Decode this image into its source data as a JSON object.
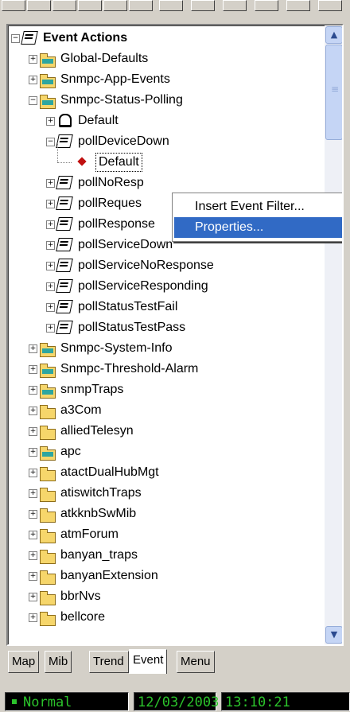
{
  "tree": {
    "rows": [
      {
        "label": "Event Actions",
        "bold": true,
        "icon": "event-actions-icon",
        "expander": "minus"
      },
      {
        "label": "Global-Defaults",
        "icon": "folder-teal-icon",
        "expander": "plus"
      },
      {
        "label": "Snmpc-App-Events",
        "icon": "folder-teal-icon",
        "expander": "plus"
      },
      {
        "label": "Snmpc-Status-Polling",
        "icon": "folder-teal-open-icon",
        "expander": "minus"
      },
      {
        "label": "Default",
        "icon": "bell-icon",
        "expander": "plus"
      },
      {
        "label": "pollDeviceDown",
        "icon": "event-action-icon",
        "expander": "minus"
      },
      {
        "label": "Default",
        "icon": "red-diamond-icon",
        "expander": "none"
      },
      {
        "label": "pollNoResp",
        "icon": "event-action-icon",
        "expander": "plus"
      },
      {
        "label": "pollReques",
        "icon": "event-action-icon",
        "expander": "plus"
      },
      {
        "label": "pollResponse",
        "icon": "event-action-icon",
        "expander": "plus"
      },
      {
        "label": "pollServiceDown",
        "icon": "event-action-icon",
        "expander": "plus"
      },
      {
        "label": "pollServiceNoResponse",
        "icon": "event-action-icon",
        "expander": "plus"
      },
      {
        "label": "pollServiceResponding",
        "icon": "event-action-icon",
        "expander": "plus"
      },
      {
        "label": "pollStatusTestFail",
        "icon": "event-action-icon",
        "expander": "plus"
      },
      {
        "label": "pollStatusTestPass",
        "icon": "event-action-icon",
        "expander": "plus"
      },
      {
        "label": "Snmpc-System-Info",
        "icon": "folder-teal-icon",
        "expander": "plus"
      },
      {
        "label": "Snmpc-Threshold-Alarm",
        "icon": "folder-teal-icon",
        "expander": "plus"
      },
      {
        "label": "snmpTraps",
        "icon": "folder-teal-icon",
        "expander": "plus"
      },
      {
        "label": "a3Com",
        "icon": "folder-icon",
        "expander": "plus"
      },
      {
        "label": "alliedTelesyn",
        "icon": "folder-icon",
        "expander": "plus"
      },
      {
        "label": "apc",
        "icon": "folder-teal-icon",
        "expander": "plus"
      },
      {
        "label": "atactDualHubMgt",
        "icon": "folder-icon",
        "expander": "plus"
      },
      {
        "label": "atiswitchTraps",
        "icon": "folder-icon",
        "expander": "plus"
      },
      {
        "label": "atkknbSwMib",
        "icon": "folder-icon",
        "expander": "plus"
      },
      {
        "label": "atmForum",
        "icon": "folder-icon",
        "expander": "plus"
      },
      {
        "label": "banyan_traps",
        "icon": "folder-icon",
        "expander": "plus"
      },
      {
        "label": "banyanExtension",
        "icon": "folder-icon",
        "expander": "plus"
      },
      {
        "label": "bbrNvs",
        "icon": "folder-icon",
        "expander": "plus"
      },
      {
        "label": "bellcore",
        "icon": "folder-icon",
        "expander": "plus"
      }
    ]
  },
  "context_menu": {
    "items": [
      {
        "label": "Insert Event Filter..."
      },
      {
        "label": "Properties...",
        "highlighted": true
      }
    ]
  },
  "tabs": [
    {
      "label": "Map"
    },
    {
      "label": "Mib"
    },
    {
      "label": "Trend"
    },
    {
      "label": "Event",
      "active": true
    },
    {
      "label": "Menu"
    }
  ],
  "status": {
    "state": "Normal",
    "date": "12/03/2003",
    "time": "13:10:21"
  },
  "colors": {
    "highlight": "#316ac5",
    "status_text": "#2bc22b",
    "folder": "#f6d66b"
  }
}
